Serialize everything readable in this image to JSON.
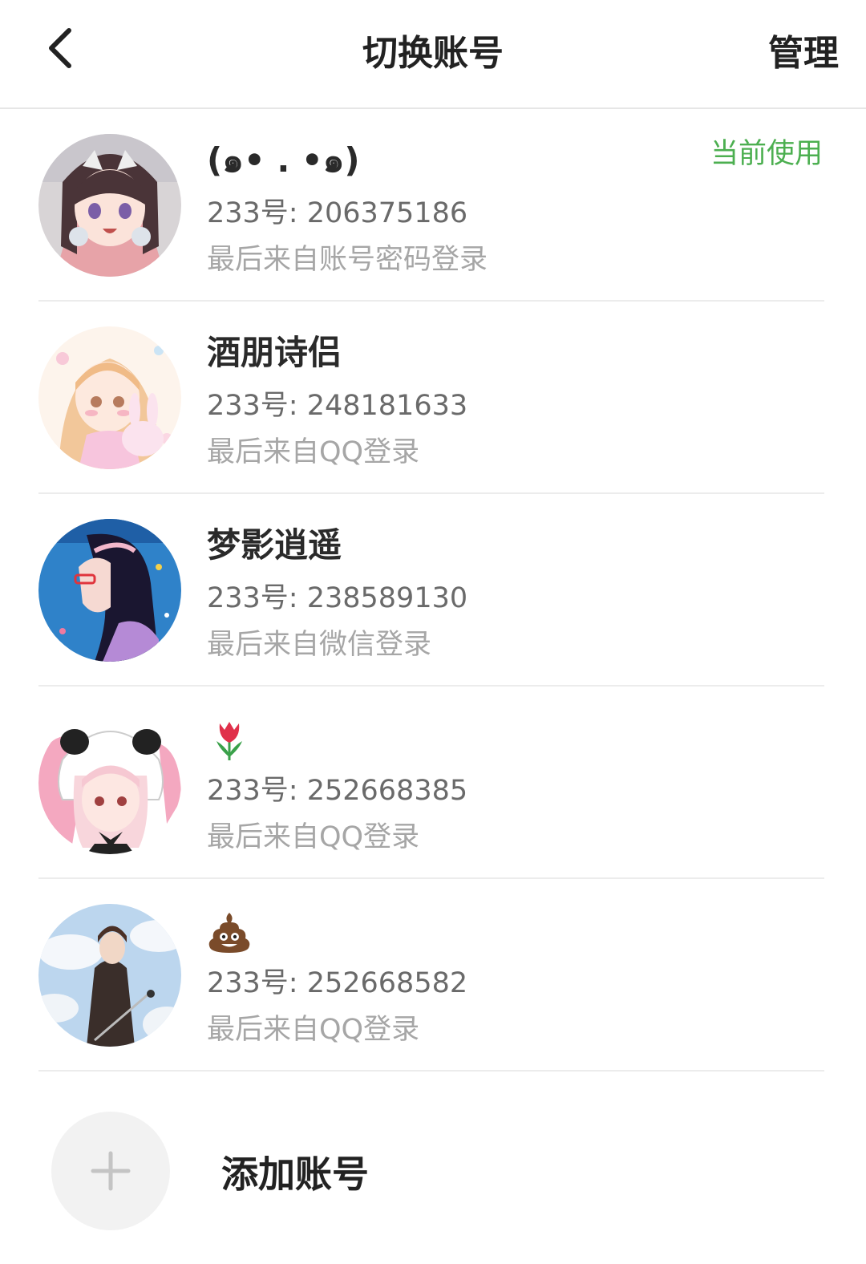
{
  "header": {
    "title": "切换账号",
    "manage_label": "管理",
    "back_icon": "chevron-left-icon"
  },
  "accounts": [
    {
      "nickname": "(๑• . •๑)",
      "uid": "233号: 206375186",
      "login_source": "最后来自账号密码登录",
      "status": "当前使用"
    },
    {
      "nickname": "酒朋诗侣",
      "uid": "233号: 248181633",
      "login_source": "最后来自QQ登录"
    },
    {
      "nickname": "梦影逍遥",
      "uid": "233号: 238589130",
      "login_source": "最后来自微信登录"
    },
    {
      "nickname_icon": "tulip-icon",
      "uid": "233号: 252668385",
      "login_source": "最后来自QQ登录"
    },
    {
      "nickname_icon": "pile-of-poo-icon",
      "uid": "233号: 252668582",
      "login_source": "最后来自QQ登录"
    }
  ],
  "add_account": {
    "label": "添加账号",
    "icon": "plus-icon"
  },
  "colors": {
    "accent_green": "#4caf50",
    "uid_text": "#6a6a6a",
    "secondary_text": "#a6a6a6",
    "divider": "#ececec"
  }
}
